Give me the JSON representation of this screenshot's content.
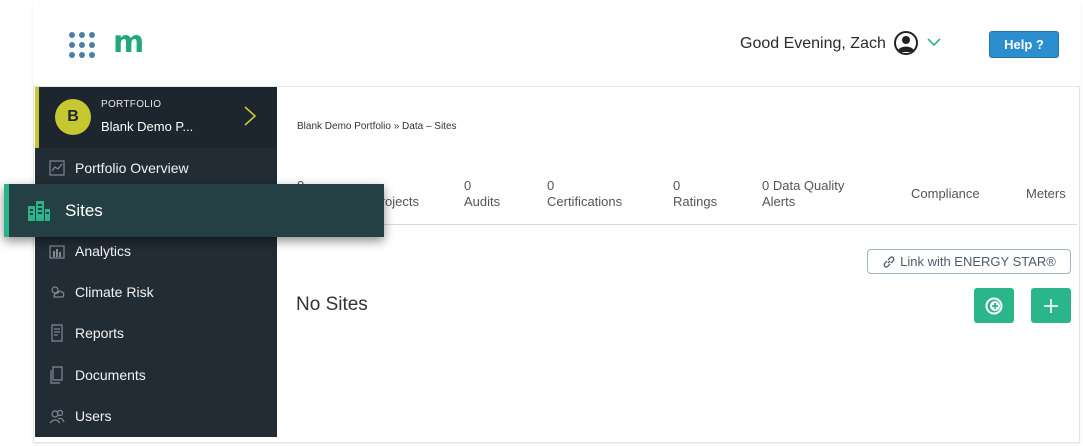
{
  "header": {
    "logo_text": "m",
    "greeting": "Good Evening, Zach",
    "help_label": "Help ?"
  },
  "sidebar": {
    "portfolio": {
      "avatar_letter": "B",
      "label": "PORTFOLIO",
      "name": "Blank Demo P..."
    },
    "items": [
      {
        "label": "Portfolio Overview",
        "icon": "chart-line-icon"
      },
      {
        "label": "Sites",
        "icon": "buildings-icon"
      },
      {
        "label": "Analytics",
        "icon": "bar-chart-icon"
      },
      {
        "label": "Climate Risk",
        "icon": "weather-icon"
      },
      {
        "label": "Reports",
        "icon": "report-icon"
      },
      {
        "label": "Documents",
        "icon": "documents-icon"
      },
      {
        "label": "Users",
        "icon": "users-icon"
      }
    ]
  },
  "popout": {
    "label": "Sites",
    "icon": "buildings-icon"
  },
  "main": {
    "breadcrumb": "Blank Demo Portfolio  »  Data – Sites",
    "tabs": [
      {
        "line1": "0",
        "line2": "Projects",
        "partial_hidden": true
      },
      {
        "line1": "0",
        "line2": "Audits"
      },
      {
        "line1": "0",
        "line2": "Certifications"
      },
      {
        "line1": "0",
        "line2": "Ratings"
      },
      {
        "line1": "0 Data Quality",
        "line2": "Alerts"
      },
      {
        "line1": "",
        "line2": "Compliance"
      },
      {
        "line1": "",
        "line2": "Meters"
      }
    ],
    "energy_star_label": "Link with ENERGY STAR®",
    "empty_title": "No Sites"
  },
  "colors": {
    "sidebar_bg": "#222c35",
    "accent_green": "#2bb58b",
    "help_blue": "#2b8fcf",
    "portfolio_accent": "#c6c832"
  }
}
